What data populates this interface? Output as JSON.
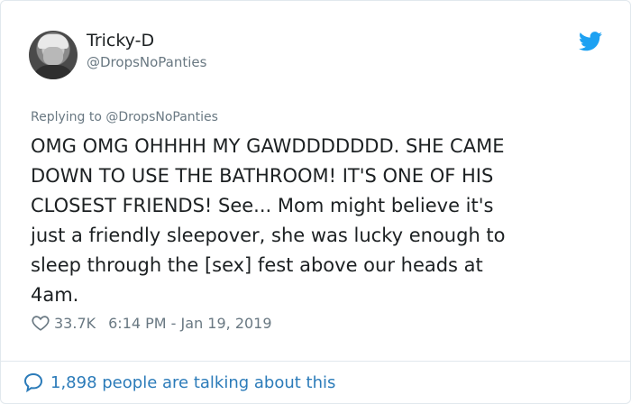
{
  "user": {
    "display_name": "Tricky-D",
    "handle": "@DropsNoPanties"
  },
  "reply": {
    "prefix": "Replying to ",
    "mention": "@DropsNoPanties"
  },
  "tweet": {
    "text": "OMG OMG OHHHH MY GAWDDDDDDD. SHE CAME\nDOWN TO USE THE BATHROOM! IT'S ONE OF HIS\nCLOSEST FRIENDS! See... Mom might believe it's\njust a friendly sleepover, she was lucky enough to\nsleep through the [sex] fest above our heads at\n4am."
  },
  "meta": {
    "likes": "33.7K",
    "timestamp": "6:14 PM - Jan 19, 2019"
  },
  "footer": {
    "talking_text": "1,898 people are talking about this"
  },
  "icons": {
    "brand": "twitter-bird-icon",
    "like": "heart-icon",
    "conversation": "speech-bubble-icon"
  },
  "colors": {
    "twitter_blue": "#1da1f2",
    "link_blue": "#2b7bb9",
    "muted": "#697882",
    "text": "#1c2022",
    "border": "#e1e8ed"
  }
}
